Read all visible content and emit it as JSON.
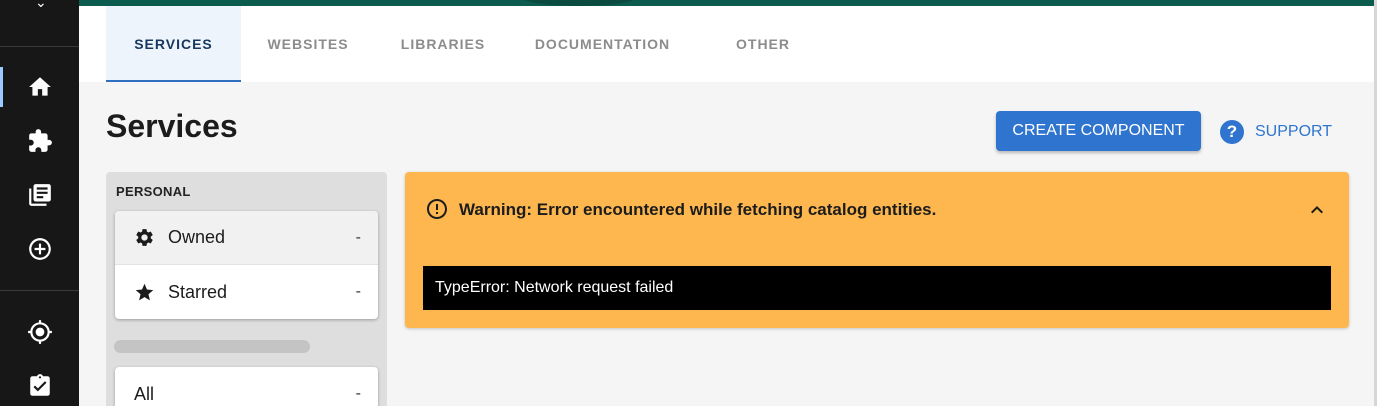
{
  "tabs": [
    "SERVICES",
    "WEBSITES",
    "LIBRARIES",
    "DOCUMENTATION",
    "OTHER"
  ],
  "page": {
    "title": "Services",
    "create_label": "CREATE COMPONENT",
    "support_label": "SUPPORT",
    "support_glyph": "?"
  },
  "sidebar": {
    "icons": [
      "home-icon",
      "extension-icon",
      "library-books-icon",
      "add-circle-icon",
      "gps-target-icon",
      "assignment-check-icon"
    ],
    "accent": "#9cc9ff",
    "background": "#171717"
  },
  "filters": {
    "personal_label": "PERSONAL",
    "items": [
      {
        "label": "Owned",
        "count": "-",
        "icon": "gear-icon"
      },
      {
        "label": "Starred",
        "count": "-",
        "icon": "star-icon"
      }
    ],
    "all": {
      "label": "All",
      "count": "-"
    }
  },
  "warning": {
    "title": "Warning: Error encountered while fetching catalog entities.",
    "message": "TypeError: Network request failed",
    "color": "#fdb74e"
  },
  "colors": {
    "primary": "#2f74cf",
    "header": "#0b5b4e",
    "tab_active_text": "#17375e"
  }
}
